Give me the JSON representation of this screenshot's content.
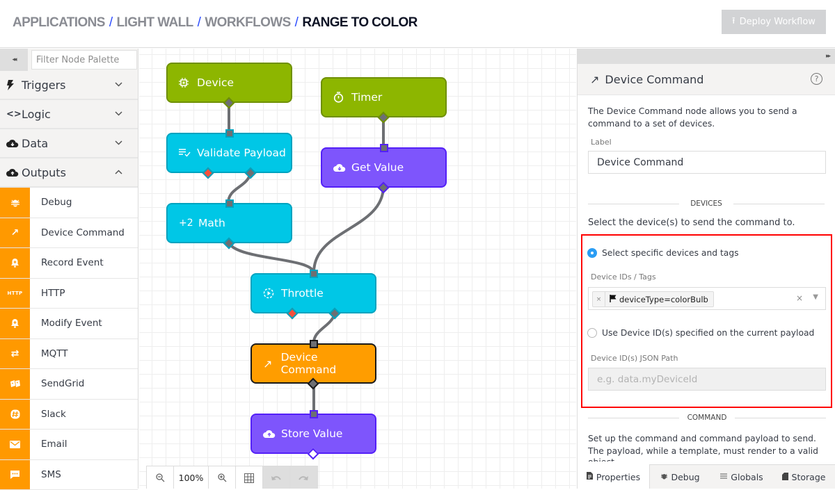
{
  "breadcrumb": {
    "items": [
      "APPLICATIONS",
      "LIGHT WALL",
      "WORKFLOWS"
    ],
    "current": "RANGE TO COLOR",
    "separator": "/"
  },
  "header": {
    "deploy_button": {
      "label": "Deploy Workflow",
      "icon": "upload-icon",
      "enabled": false
    }
  },
  "palette": {
    "collapse_icon": "◂◂",
    "filter_placeholder": "Filter Node Palette",
    "categories": [
      {
        "label": "Triggers",
        "icon": "⚡",
        "expanded": false,
        "chevron": "⌄"
      },
      {
        "label": "Logic",
        "icon": "<>",
        "expanded": false,
        "chevron": "⌄"
      },
      {
        "label": "Data",
        "icon": "☁",
        "expanded": false,
        "chevron": "⌄"
      },
      {
        "label": "Outputs",
        "icon": "☁",
        "expanded": true,
        "chevron": "⌃"
      }
    ],
    "outputs": [
      {
        "label": "Debug",
        "icon": "bug-icon",
        "glyph": "✱"
      },
      {
        "label": "Device Command",
        "icon": "arrow-up-right-icon",
        "glyph": "↗"
      },
      {
        "label": "Record Event",
        "icon": "bell-plus-icon",
        "glyph": "🔔"
      },
      {
        "label": "HTTP",
        "icon": "http-icon",
        "glyph": "HTTP"
      },
      {
        "label": "Modify Event",
        "icon": "bell-plus-icon",
        "glyph": "🔔"
      },
      {
        "label": "MQTT",
        "icon": "exchange-icon",
        "glyph": "⇄"
      },
      {
        "label": "SendGrid",
        "icon": "sendgrid-icon",
        "glyph": "✉"
      },
      {
        "label": "Slack",
        "icon": "slack-icon",
        "glyph": "#"
      },
      {
        "label": "Email",
        "icon": "envelope-icon",
        "glyph": "✉"
      },
      {
        "label": "SMS",
        "icon": "chat-icon",
        "glyph": "…"
      }
    ]
  },
  "canvas": {
    "nodes": [
      {
        "id": "device",
        "label": "Device",
        "type": "trigger",
        "icon": "chip-icon",
        "glyph": "⊡"
      },
      {
        "id": "timer",
        "label": "Timer",
        "type": "trigger",
        "icon": "stopwatch-icon",
        "glyph": "⏱"
      },
      {
        "id": "validate",
        "label": "Validate Payload",
        "type": "logic",
        "icon": "list-check-icon",
        "glyph": "≡✓"
      },
      {
        "id": "getvalue",
        "label": "Get Value",
        "type": "data",
        "icon": "cloud-download-icon",
        "glyph": "☁"
      },
      {
        "id": "math",
        "label": "Math",
        "type": "logic",
        "icon": "plus-two-icon",
        "glyph": "+2"
      },
      {
        "id": "throttle",
        "label": "Throttle",
        "type": "logic",
        "icon": "throttle-icon",
        "glyph": "◌"
      },
      {
        "id": "devcmd",
        "label": "Device Command",
        "type": "output",
        "icon": "arrow-up-right-icon",
        "glyph": "↗",
        "selected": true
      },
      {
        "id": "store",
        "label": "Store Value",
        "type": "data",
        "icon": "cloud-upload-icon",
        "glyph": "☁"
      }
    ],
    "edges": [
      {
        "from": "device",
        "to": "validate"
      },
      {
        "from": "timer",
        "to": "getvalue"
      },
      {
        "from": "validate",
        "port": "true",
        "to": "math"
      },
      {
        "from": "math",
        "to": "throttle"
      },
      {
        "from": "getvalue",
        "to": "throttle"
      },
      {
        "from": "throttle",
        "port": "true",
        "to": "devcmd"
      },
      {
        "from": "devcmd",
        "to": "store"
      }
    ],
    "zoom": {
      "zoom_out_icon": "zoom-out-icon",
      "level": "100%",
      "zoom_in_icon": "zoom-in-icon",
      "grid_icon": "grid-icon",
      "undo_icon": "undo-icon",
      "redo_icon": "redo-icon"
    }
  },
  "panel": {
    "collapse_icon": "▸▸",
    "title": "Device Command",
    "title_icon": "↗",
    "help_icon": "?",
    "description": "The Device Command node allows you to send a command to a set of devices.",
    "label_field": {
      "label": "Label",
      "value": "Device Command"
    },
    "devices_section": {
      "heading": "DEVICES",
      "description": "Select the device(s) to send the command to.",
      "option_specific": {
        "label": "Select specific devices and tags",
        "checked": true
      },
      "ids_tags_label": "Device IDs / Tags",
      "tags": [
        {
          "text": "deviceType=colorBulb",
          "icon": "flag-icon",
          "remove": "×"
        }
      ],
      "clear_icon": "×",
      "dropdown_icon": "▼",
      "option_payload": {
        "label": "Use Device ID(s) specified on the current payload",
        "checked": false
      },
      "json_path_label": "Device ID(s) JSON Path",
      "json_path_placeholder": "e.g. data.myDeviceId"
    },
    "command_section": {
      "heading": "COMMAND",
      "description": "Set up the command and command payload to send. The payload, while a template, must render to a valid JSON",
      "description_overflow": "object."
    },
    "tabs": [
      {
        "label": "Properties",
        "icon": "document-icon",
        "glyph": "▤",
        "active": true
      },
      {
        "label": "Debug",
        "icon": "bug-icon",
        "glyph": "✱",
        "active": false
      },
      {
        "label": "Globals",
        "icon": "list-icon",
        "glyph": "≡",
        "active": false
      },
      {
        "label": "Storage",
        "icon": "sd-card-icon",
        "glyph": "▮",
        "active": false
      }
    ]
  },
  "colors": {
    "trigger": "#8db600",
    "logic": "#00c7e6",
    "data": "#7e55fc",
    "output": "#ff9d00",
    "accent": "#2a4bff",
    "highlight": "#ff0000",
    "radio_selected": "#2a9df4"
  }
}
